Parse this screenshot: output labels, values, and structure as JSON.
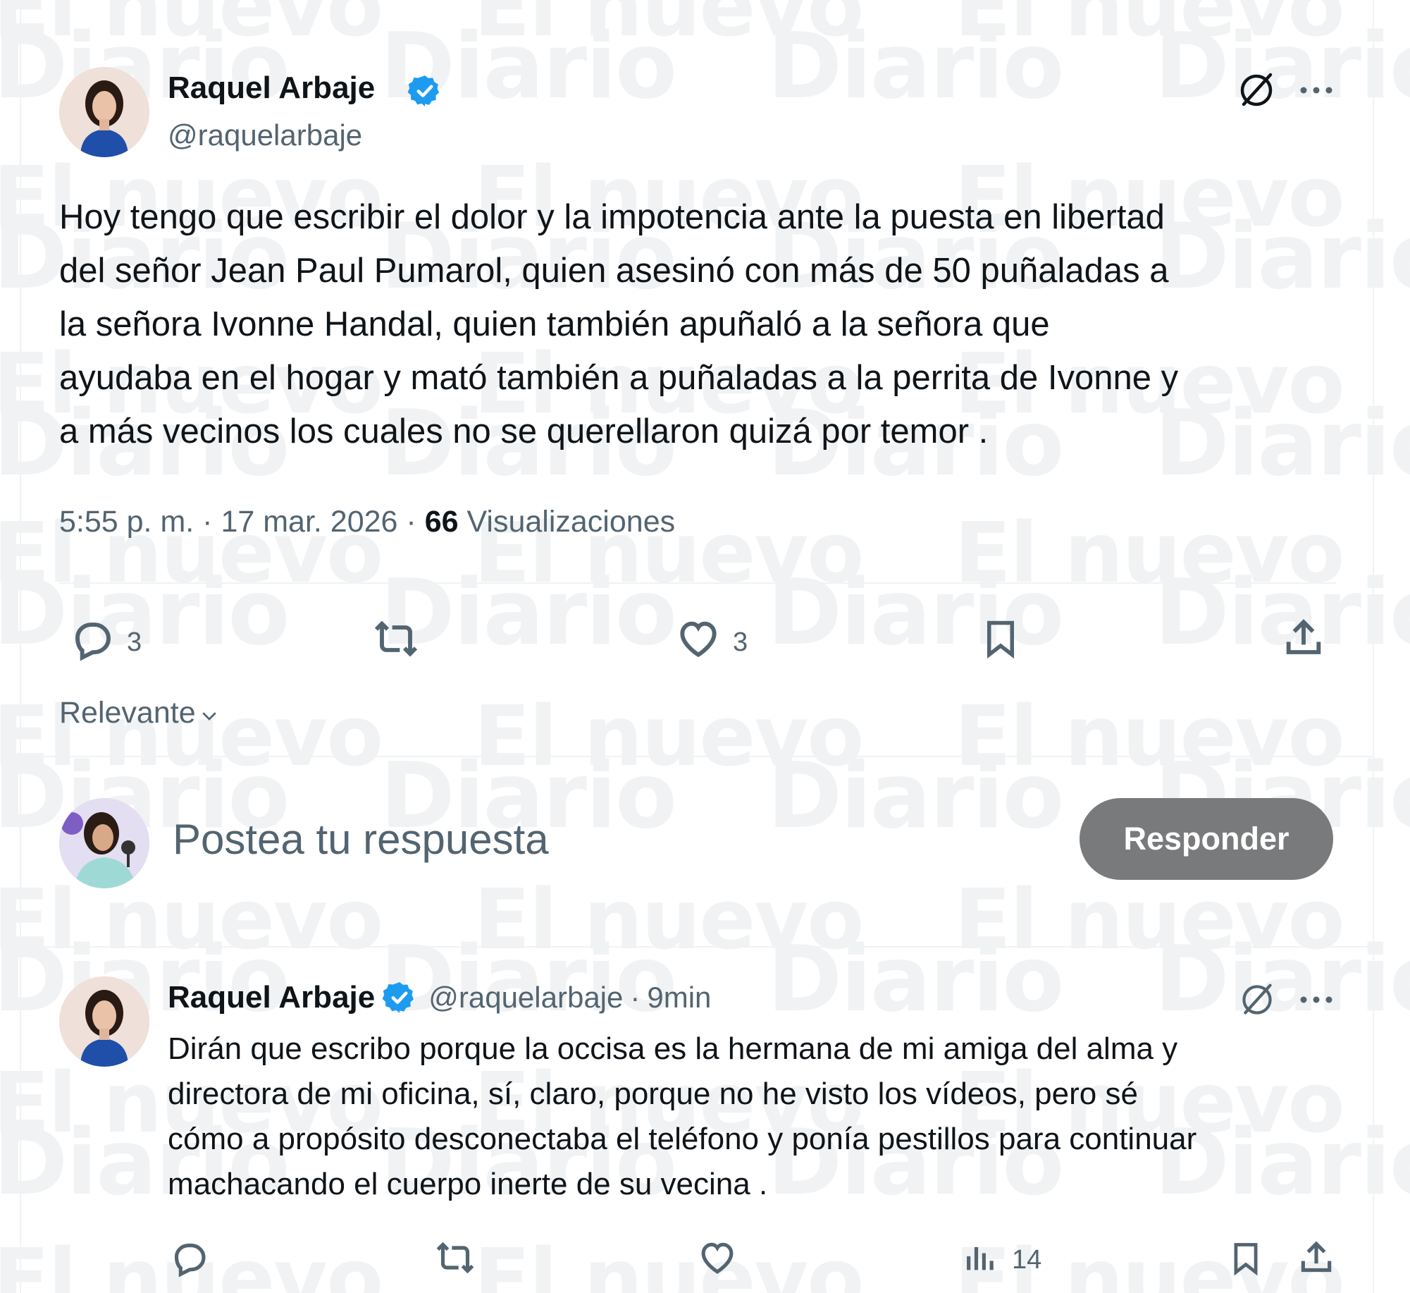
{
  "watermark": {
    "line1": "El nuevo",
    "line2": "Diario"
  },
  "main_tweet": {
    "author_name": "Raquel Arbaje",
    "author_handle": "@raquelarbaje",
    "body_lines": [
      "Hoy tengo que escribir el dolor y la impotencia ante la puesta en libertad",
      "del señor Jean Paul Pumarol, quien asesinó con más de 50 puñaladas a",
      "la señora Ivonne Handal, quien también apuñaló a la señora que",
      "ayudaba en el hogar y mató también a puñaladas a la perrita de Ivonne y",
      "a más vecinos los cuales no se querellaron quizá por temor ."
    ],
    "time": "5:55 p. m.",
    "date": "17 mar. 2026",
    "views_count": "66",
    "views_label": "Visualizaciones",
    "reply_count": "3",
    "like_count": "3"
  },
  "sort": {
    "label": "Relevante"
  },
  "composer": {
    "placeholder": "Postea tu respuesta",
    "button_label": "Responder"
  },
  "reply_tweet": {
    "author_name": "Raquel Arbaje",
    "author_handle": "@raquelarbaje",
    "time_ago": "9min",
    "body_lines": [
      "Dirán que escribo porque la occisa es la hermana de mi amiga del alma y",
      "directora de mi oficina, sí, claro, porque no he visto los vídeos, pero sé",
      "cómo a propósito desconectaba el teléfono y ponía pestillos para continuar",
      "machacando el cuerpo inerte de su vecina ."
    ],
    "views_count": "14"
  },
  "colors": {
    "verified_blue": "#1d9bf0",
    "text_primary": "#0f1419",
    "text_secondary": "#536471",
    "button_bg": "#787a7c"
  }
}
